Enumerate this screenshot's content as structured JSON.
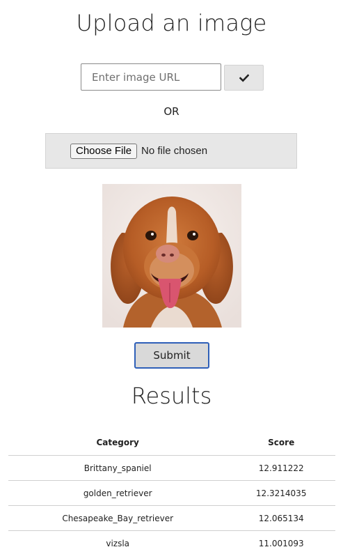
{
  "header": {
    "title": "Upload an image"
  },
  "url_form": {
    "placeholder": "Enter image URL",
    "value": "",
    "submit_icon": "check-icon"
  },
  "separator_text": "OR",
  "file_input": {
    "button_label": "Choose File",
    "status": "No file chosen"
  },
  "preview": {
    "icon": "dog-photo"
  },
  "submit": {
    "label": "Submit"
  },
  "results": {
    "title": "Results",
    "columns": [
      "Category",
      "Score"
    ],
    "rows": [
      {
        "category": "Brittany_spaniel",
        "score": "12.911222"
      },
      {
        "category": "golden_retriever",
        "score": "12.3214035"
      },
      {
        "category": "Chesapeake_Bay_retriever",
        "score": "12.065134"
      },
      {
        "category": "vizsla",
        "score": "11.001093"
      }
    ]
  },
  "colors": {
    "submit_border": "#2e5fb8",
    "panel_bg": "#e7e7e7",
    "dog_fur": "#b85f2a"
  }
}
